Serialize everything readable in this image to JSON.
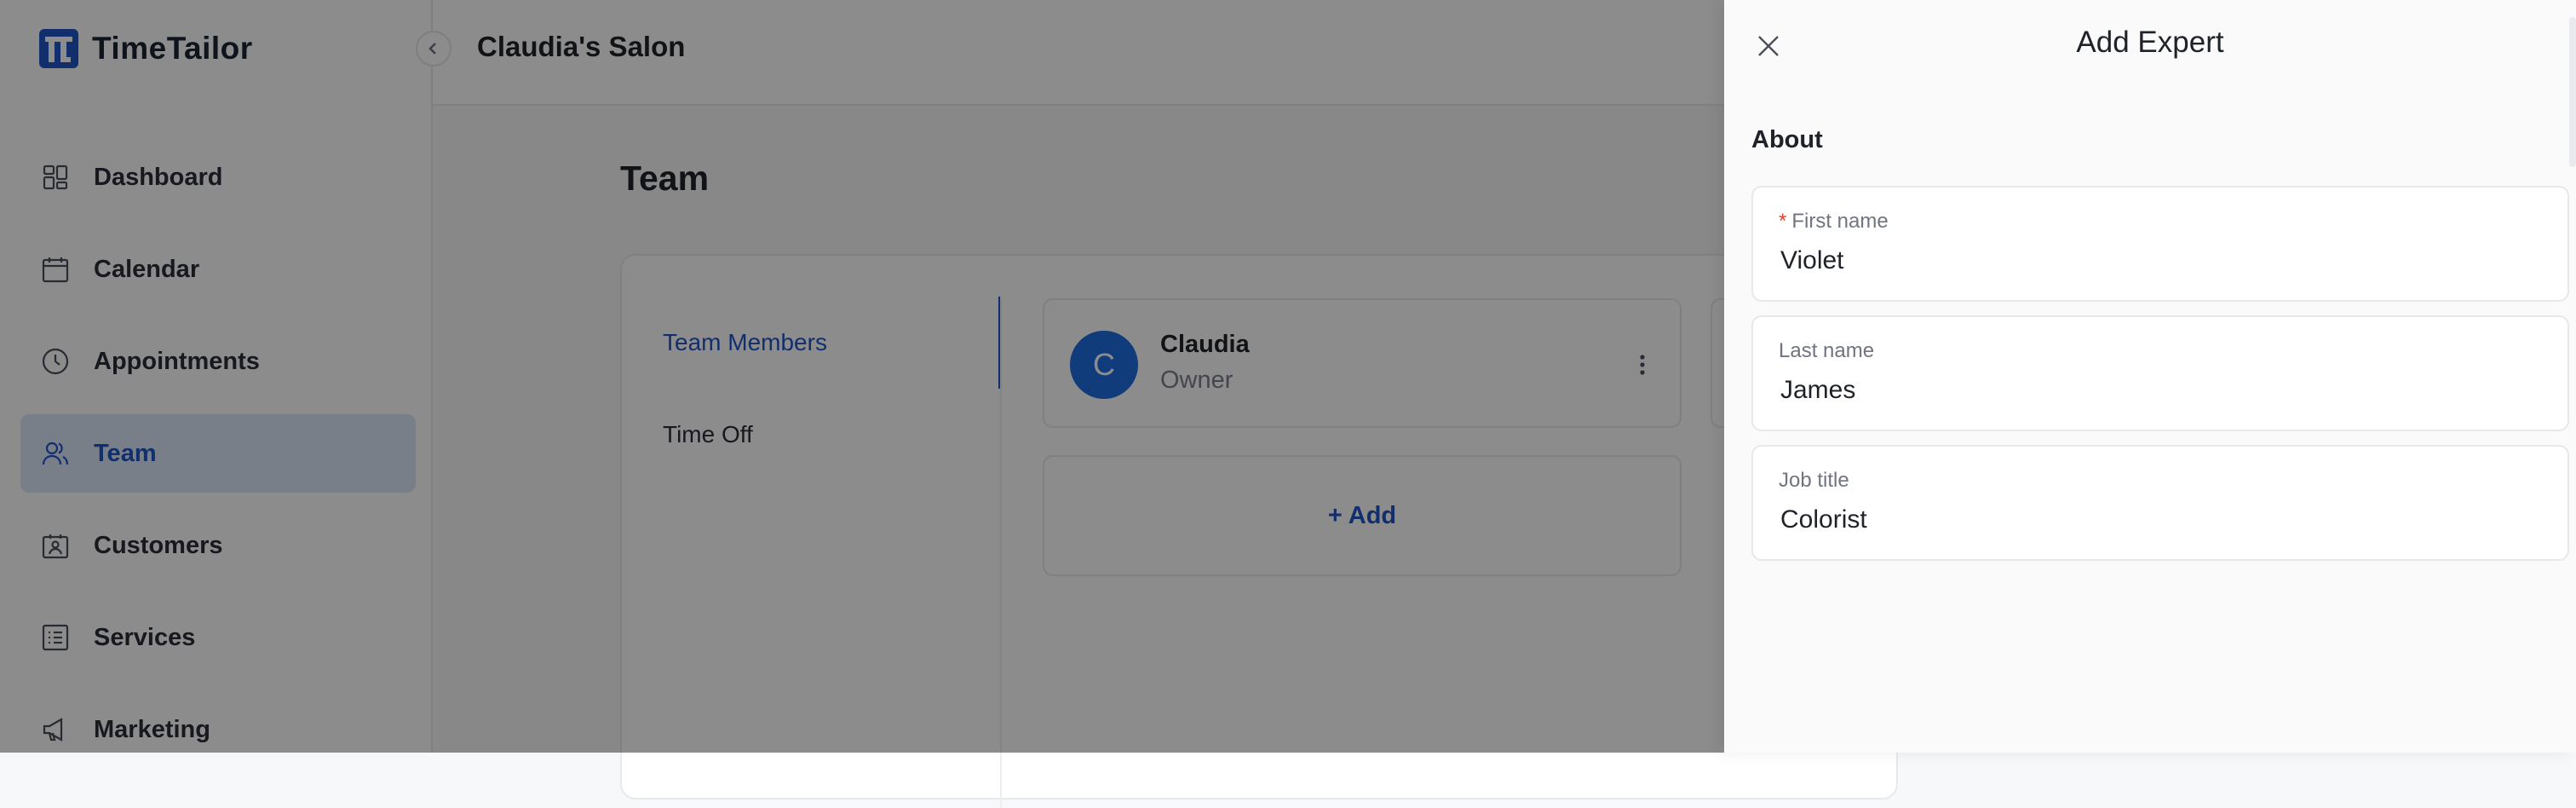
{
  "app": {
    "brand": "TimeTailor",
    "salon_name": "Claudia's Salon"
  },
  "colors": {
    "accent": "#1f55c7",
    "avatar": "#1f6ee0",
    "required": "#e0422b",
    "active_nav_bg": "#dde8fa"
  },
  "sidebar": {
    "items": [
      {
        "label": "Dashboard",
        "icon": "dashboard-icon",
        "active": false
      },
      {
        "label": "Calendar",
        "icon": "calendar-icon",
        "active": false
      },
      {
        "label": "Appointments",
        "icon": "clock-icon",
        "active": false
      },
      {
        "label": "Team",
        "icon": "team-icon",
        "active": true
      },
      {
        "label": "Customers",
        "icon": "customers-icon",
        "active": false
      },
      {
        "label": "Services",
        "icon": "services-icon",
        "active": false
      },
      {
        "label": "Marketing",
        "icon": "megaphone-icon",
        "active": false
      }
    ]
  },
  "main": {
    "page_title": "Team",
    "tabs": [
      {
        "label": "Team Members",
        "active": true
      },
      {
        "label": "Time Off",
        "active": false
      }
    ],
    "member": {
      "initial": "C",
      "name": "Claudia",
      "role": "Owner"
    },
    "add_label": "+ Add"
  },
  "drawer": {
    "title": "Add Expert",
    "section": "About",
    "fields": [
      {
        "label": "First name",
        "required": true,
        "value": "Violet"
      },
      {
        "label": "Last name",
        "required": false,
        "value": "James"
      },
      {
        "label": "Job title",
        "required": false,
        "value": "Colorist"
      }
    ],
    "required_marker": "*"
  }
}
